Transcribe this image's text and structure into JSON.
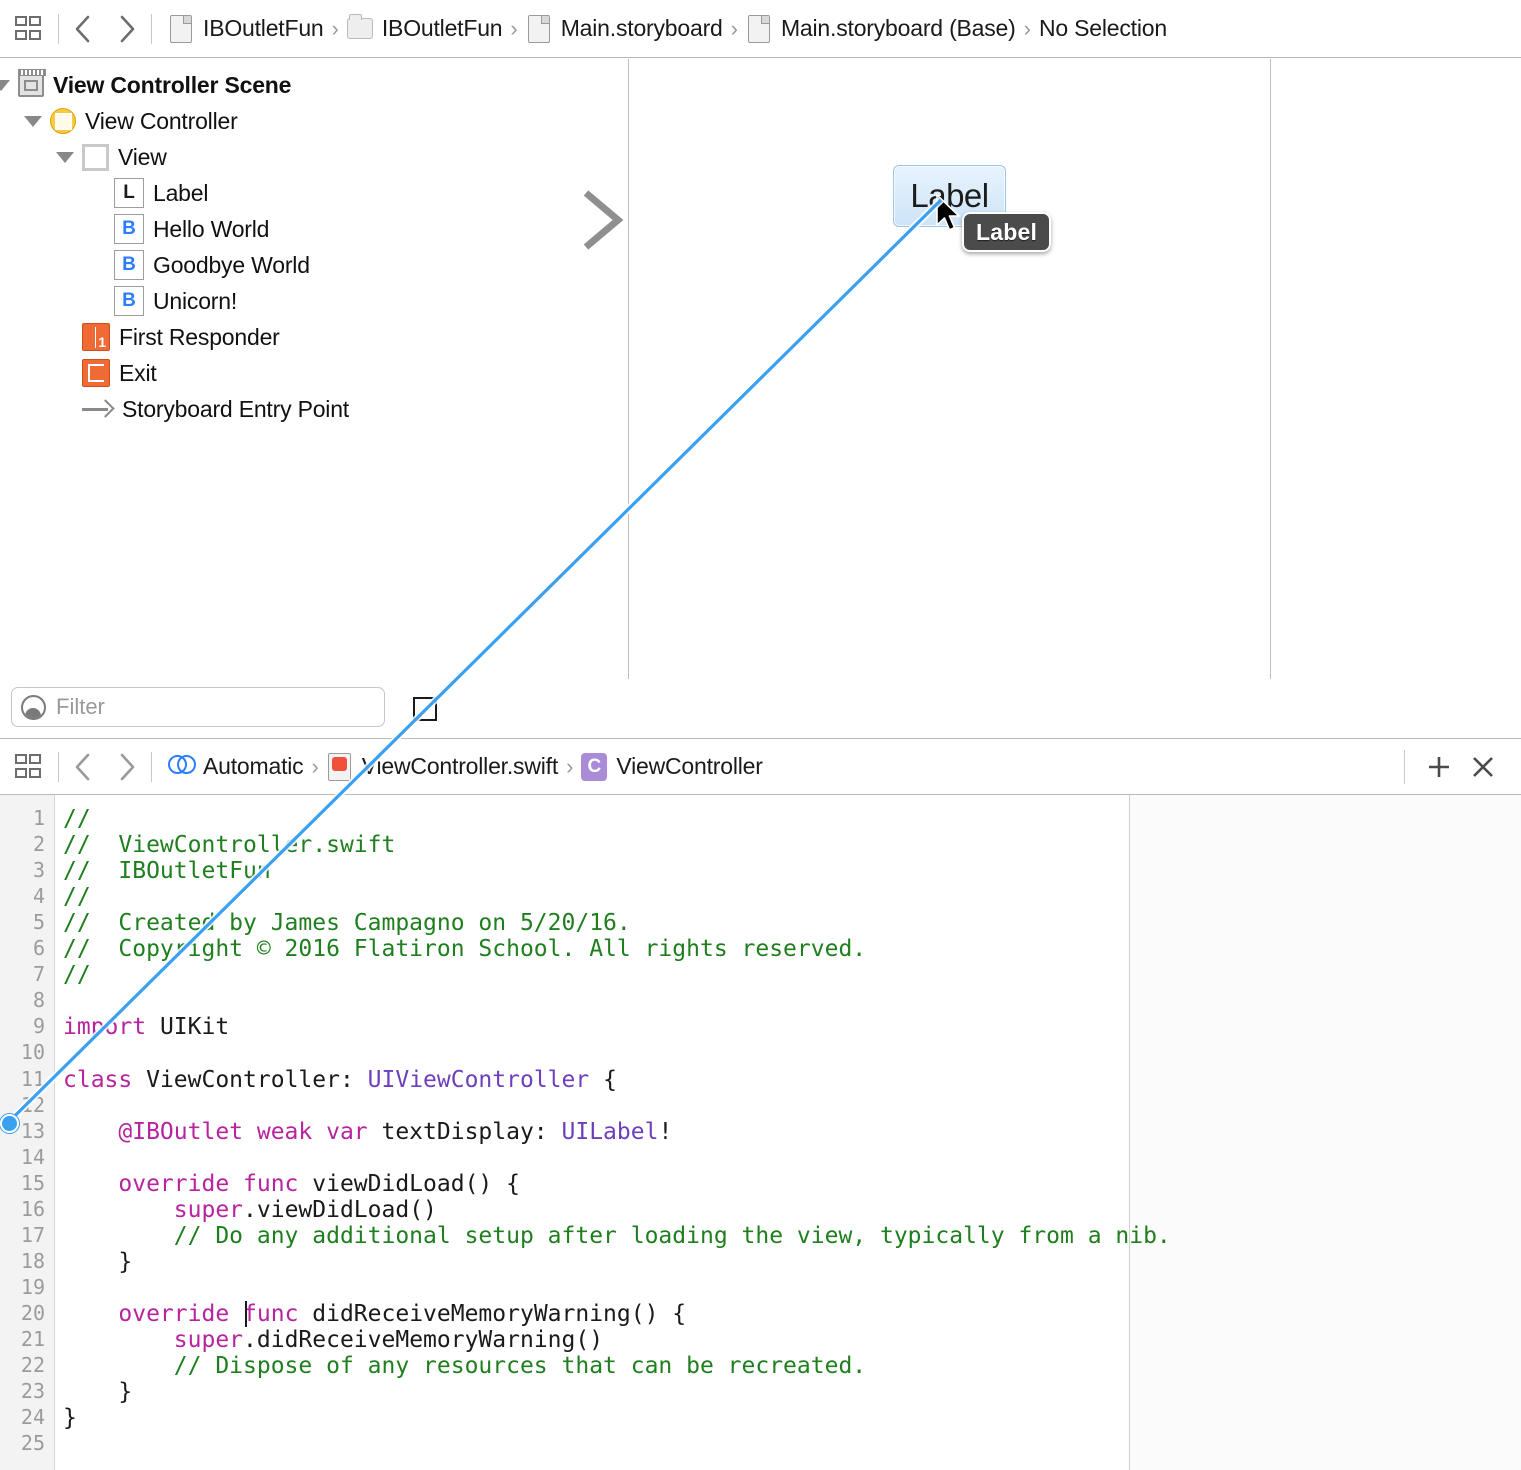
{
  "topbar": {
    "grid_icon": "related-items-icon",
    "back_icon": "chevron-left-icon",
    "forward_icon": "chevron-right-icon",
    "breadcrumbs": [
      {
        "label": "IBOutletFun",
        "icon": "project-icon"
      },
      {
        "label": "IBOutletFun",
        "icon": "folder-icon"
      },
      {
        "label": "Main.storyboard",
        "icon": "storyboard-icon"
      },
      {
        "label": "Main.storyboard (Base)",
        "icon": "storyboard-icon"
      },
      {
        "label": "No Selection",
        "icon": "none"
      }
    ],
    "separator": "›"
  },
  "outline": {
    "items": [
      {
        "label": "View Controller Scene",
        "icon": "scene-icon",
        "indent": 0,
        "twisty": true,
        "bold": true
      },
      {
        "label": "View Controller",
        "icon": "view-controller-icon",
        "indent": 1,
        "twisty": true,
        "bold": false
      },
      {
        "label": "View",
        "icon": "view-icon",
        "indent": 2,
        "twisty": true,
        "bold": false
      },
      {
        "label": "Label",
        "icon": "label-icon",
        "indent": 3,
        "twisty": false,
        "bold": false,
        "glyph": "L"
      },
      {
        "label": "Hello World",
        "icon": "button-icon",
        "indent": 3,
        "twisty": false,
        "bold": false,
        "glyph": "B"
      },
      {
        "label": "Goodbye World",
        "icon": "button-icon",
        "indent": 3,
        "twisty": false,
        "bold": false,
        "glyph": "B"
      },
      {
        "label": "Unicorn!",
        "icon": "button-icon",
        "indent": 3,
        "twisty": false,
        "bold": false,
        "glyph": "B"
      },
      {
        "label": "First Responder",
        "icon": "first-responder-icon",
        "indent": 2,
        "twisty": false,
        "bold": false
      },
      {
        "label": "Exit",
        "icon": "exit-icon",
        "indent": 2,
        "twisty": false,
        "bold": false
      },
      {
        "label": "Storyboard Entry Point",
        "icon": "entry-point-arrow-icon",
        "indent": 2,
        "twisty": false,
        "bold": false
      }
    ]
  },
  "filter": {
    "placeholder": "Filter",
    "value": "",
    "icon": "filter-icon"
  },
  "canvas": {
    "label_element": {
      "text": "Label"
    },
    "tooltip": {
      "text": "Label"
    },
    "entry_arrow_icon": "storyboard-entry-arrow-icon",
    "cursor_icon": "mouse-pointer-icon",
    "mini_view_controller_icon": "view-controller-mini-icon",
    "connection_line_color": "#3aa0f2"
  },
  "editorbar": {
    "grid_icon": "related-items-icon",
    "back_icon": "chevron-left-icon",
    "forward_icon": "chevron-right-icon",
    "breadcrumbs": [
      {
        "label": "Automatic",
        "icon": "assistant-editor-icon"
      },
      {
        "label": "ViewController.swift",
        "icon": "swift-file-icon"
      },
      {
        "label": "ViewController",
        "icon": "class-icon",
        "glyph": "C"
      }
    ],
    "separator": "›",
    "add_label": "+",
    "close_label": "×",
    "add_icon": "plus-icon",
    "close_icon": "close-icon"
  },
  "code": {
    "first_line": 1,
    "last_line": 25,
    "caret_line": 20,
    "caret_col": 13,
    "connection_dot_line": 13,
    "lines": [
      {
        "n": 1,
        "tokens": [
          {
            "t": "//",
            "c": "cmt"
          }
        ]
      },
      {
        "n": 2,
        "tokens": [
          {
            "t": "//  ViewController.swift",
            "c": "cmt"
          }
        ]
      },
      {
        "n": 3,
        "tokens": [
          {
            "t": "//  IBOutletFun",
            "c": "cmt"
          }
        ]
      },
      {
        "n": 4,
        "tokens": [
          {
            "t": "//",
            "c": "cmt"
          }
        ]
      },
      {
        "n": 5,
        "tokens": [
          {
            "t": "//  Created by James Campagno on 5/20/16.",
            "c": "cmt"
          }
        ]
      },
      {
        "n": 6,
        "tokens": [
          {
            "t": "//  Copyright © 2016 Flatiron School. All rights reserved.",
            "c": "cmt"
          }
        ]
      },
      {
        "n": 7,
        "tokens": [
          {
            "t": "//",
            "c": "cmt"
          }
        ]
      },
      {
        "n": 8,
        "tokens": []
      },
      {
        "n": 9,
        "tokens": [
          {
            "t": "import",
            "c": "key"
          },
          {
            "t": " UIKit",
            "c": "pln"
          }
        ]
      },
      {
        "n": 10,
        "tokens": []
      },
      {
        "n": 11,
        "tokens": [
          {
            "t": "class",
            "c": "key"
          },
          {
            "t": " ViewController: ",
            "c": "pln"
          },
          {
            "t": "UIViewController",
            "c": "typ"
          },
          {
            "t": " {",
            "c": "pln"
          }
        ]
      },
      {
        "n": 12,
        "tokens": []
      },
      {
        "n": 13,
        "tokens": [
          {
            "t": "    ",
            "c": "pln"
          },
          {
            "t": "@IBOutlet weak var",
            "c": "key"
          },
          {
            "t": " textDisplay: ",
            "c": "pln"
          },
          {
            "t": "UILabel",
            "c": "typ"
          },
          {
            "t": "!",
            "c": "pln"
          }
        ]
      },
      {
        "n": 14,
        "tokens": []
      },
      {
        "n": 15,
        "tokens": [
          {
            "t": "    ",
            "c": "pln"
          },
          {
            "t": "override func",
            "c": "key"
          },
          {
            "t": " viewDidLoad() {",
            "c": "pln"
          }
        ]
      },
      {
        "n": 16,
        "tokens": [
          {
            "t": "        ",
            "c": "pln"
          },
          {
            "t": "super",
            "c": "key"
          },
          {
            "t": ".viewDidLoad()",
            "c": "pln"
          }
        ]
      },
      {
        "n": 17,
        "tokens": [
          {
            "t": "        ",
            "c": "pln"
          },
          {
            "t": "// Do any additional setup after loading the view, typically from a nib.",
            "c": "cmt"
          }
        ]
      },
      {
        "n": 18,
        "tokens": [
          {
            "t": "    }",
            "c": "pln"
          }
        ]
      },
      {
        "n": 19,
        "tokens": []
      },
      {
        "n": 20,
        "tokens": [
          {
            "t": "    ",
            "c": "pln"
          },
          {
            "t": "override",
            "c": "key"
          },
          {
            "t": " ",
            "c": "pln"
          },
          {
            "t": "func",
            "c": "key"
          },
          {
            "t": " didReceiveMemoryWarning() {",
            "c": "pln"
          }
        ]
      },
      {
        "n": 21,
        "tokens": [
          {
            "t": "        ",
            "c": "pln"
          },
          {
            "t": "super",
            "c": "key"
          },
          {
            "t": ".didReceiveMemoryWarning()",
            "c": "pln"
          }
        ]
      },
      {
        "n": 22,
        "tokens": [
          {
            "t": "        ",
            "c": "pln"
          },
          {
            "t": "// Dispose of any resources that can be recreated.",
            "c": "cmt"
          }
        ]
      },
      {
        "n": 23,
        "tokens": [
          {
            "t": "    }",
            "c": "pln"
          }
        ]
      },
      {
        "n": 24,
        "tokens": [
          {
            "t": "}",
            "c": "pln"
          }
        ]
      },
      {
        "n": 25,
        "tokens": []
      }
    ]
  },
  "colors": {
    "comment": "#1f7f1f",
    "keyword": "#b8239e",
    "type": "#6d3fbd",
    "plain": "#1a1a1a",
    "connection": "#3aa0f2",
    "accent_blue": "#2d7dff"
  }
}
